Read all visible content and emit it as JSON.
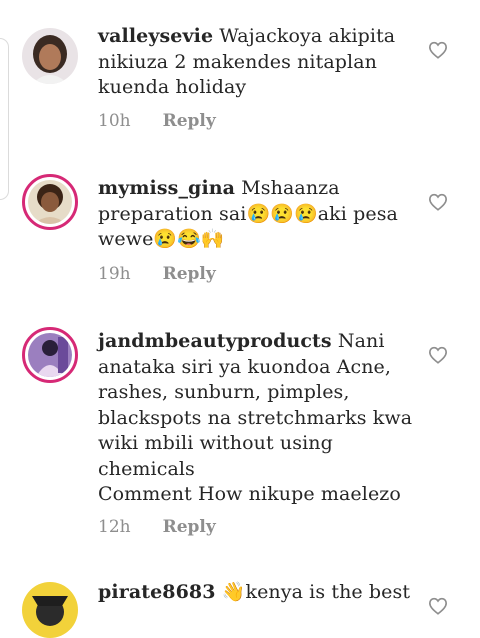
{
  "comments": [
    {
      "username": "valleysevie",
      "text": "Wajackoya akipita nikiuza 2 makendes nitaplan kuenda holiday",
      "time": "10h",
      "reply": "Reply"
    },
    {
      "username": "mymiss_gina",
      "text": "Mshaanza preparation sai😢😢😢aki pesa wewe😢😂🙌",
      "time": "19h",
      "reply": "Reply"
    },
    {
      "username": "jandmbeautyproducts",
      "text": "Nani anataka siri ya kuondoa Acne, rashes, sunburn, pimples, blackspots na stretchmarks kwa wiki mbili without using chemicals",
      "text2": "Comment How nikupe maelezo",
      "time": "12h",
      "reply": "Reply"
    },
    {
      "username": "pirate8683",
      "text": "👋kenya is the best",
      "time": "",
      "reply": ""
    }
  ],
  "colors": {
    "story_ring": "#d62976",
    "meta": "#8e8e8e"
  },
  "icons": {
    "like": "heart-outline-icon"
  }
}
